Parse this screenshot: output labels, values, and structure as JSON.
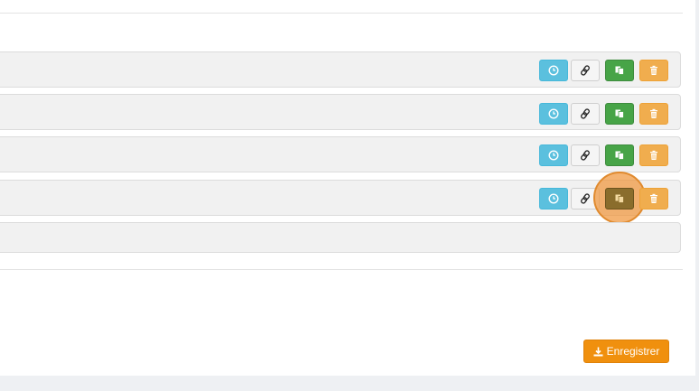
{
  "rows": [
    {
      "id": "row-1"
    },
    {
      "id": "row-2"
    },
    {
      "id": "row-3"
    },
    {
      "id": "row-4"
    }
  ],
  "row_actions": {
    "icons": [
      "clock-icon",
      "link-icon",
      "copy-icon",
      "trash-icon"
    ]
  },
  "footer": {
    "save_label": "Enregistrer",
    "save_icon": "download-icon"
  },
  "colors": {
    "info": "#5bc0de",
    "default": "#f5f5f5",
    "success": "#47a447",
    "warning": "#f0ad4e",
    "primary_orange": "#f0900e",
    "highlight": "#f0963c"
  }
}
